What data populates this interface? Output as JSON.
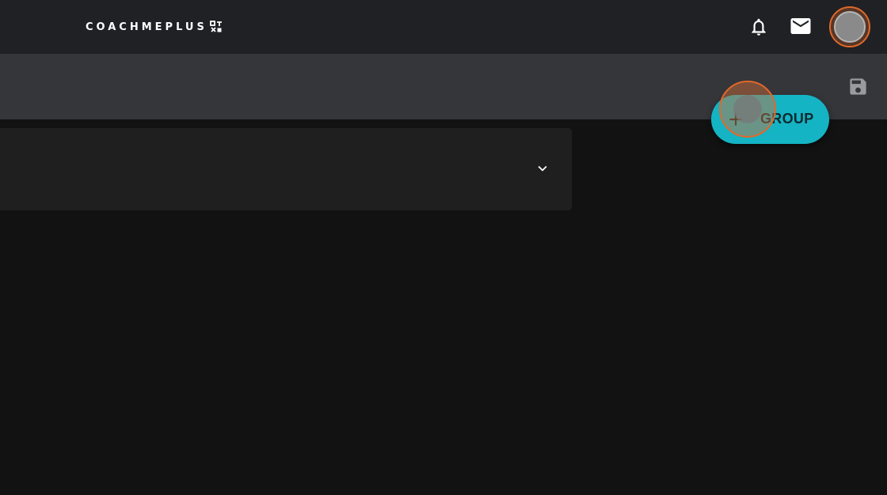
{
  "header": {
    "logo_text": "COACHMEPLUS",
    "icons": {
      "notifications": "bell-icon",
      "messages": "mail-icon",
      "profile": "avatar"
    }
  },
  "toolbar": {
    "save_icon": "save-icon"
  },
  "panel": {
    "expand_icon": "chevron-down-icon"
  },
  "actions": {
    "group_button_label": "GROUP",
    "group_button_icon": "plus-icon"
  },
  "colors": {
    "topbar": "#202124",
    "subbar": "#35363a",
    "background": "#121212",
    "panel": "#1f1f1f",
    "accent": "#14b4c4",
    "highlight": "#e0682a"
  }
}
